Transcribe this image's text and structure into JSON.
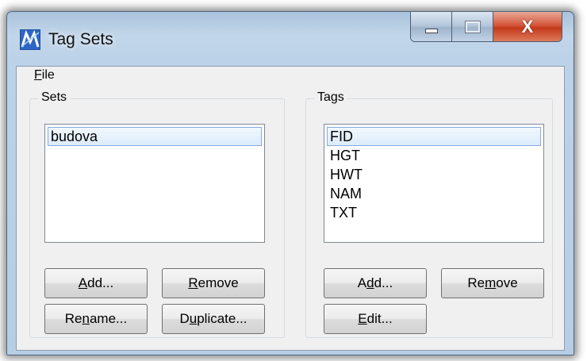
{
  "window": {
    "title": "Tag Sets",
    "app_icon": "microstation-icon",
    "caption_buttons": {
      "minimize_icon": "minimize-icon",
      "maximize_icon": "maximize-icon",
      "close_icon": "close-icon",
      "close_glyph": "X"
    }
  },
  "menu": {
    "file_label": "File",
    "file_accel": "F",
    "file_rest": "ile"
  },
  "sets": {
    "label": "Sets",
    "items": [
      "budova"
    ],
    "selected_index": 0,
    "buttons": {
      "add": {
        "pre": "",
        "accel": "A",
        "post": "dd..."
      },
      "remove": {
        "pre": "",
        "accel": "R",
        "post": "emove"
      },
      "rename": {
        "pre": "Re",
        "accel": "n",
        "post": "ame..."
      },
      "duplicate": {
        "pre": "D",
        "accel": "u",
        "post": "plicate..."
      }
    }
  },
  "tags": {
    "label": "Tags",
    "items": [
      "FID",
      "HGT",
      "HWT",
      "NAM",
      "TXT"
    ],
    "selected_index": 0,
    "buttons": {
      "add": {
        "pre": "A",
        "accel": "d",
        "post": "d..."
      },
      "remove": {
        "pre": "Re",
        "accel": "m",
        "post": "ove"
      },
      "edit": {
        "pre": "",
        "accel": "E",
        "post": "dit..."
      }
    }
  },
  "colors": {
    "title_bar": "#bcd2e8",
    "close_button": "#c3391b",
    "selection_border": "#84acdd",
    "client_background": "#f0f0f0"
  }
}
